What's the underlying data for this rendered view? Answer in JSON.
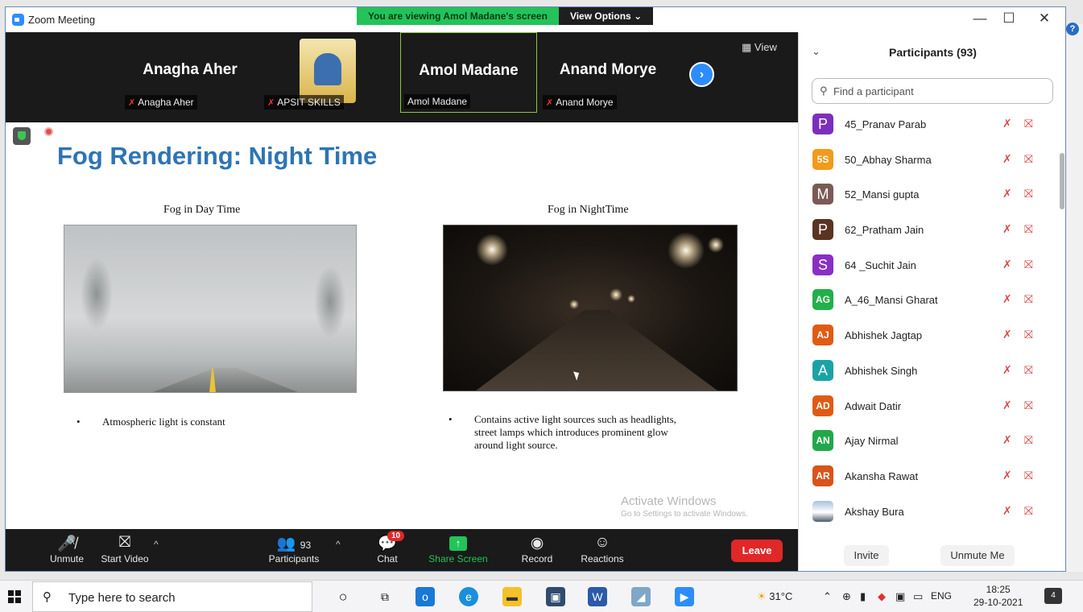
{
  "window": {
    "title": "Zoom Meeting",
    "minimize": "—",
    "maximize": "☐",
    "close": "✕"
  },
  "banner": {
    "viewing_text": "You are viewing Amol Madane's screen",
    "options_label": "View Options ⌄"
  },
  "video_strip": {
    "view_label": "View",
    "tiles": [
      {
        "display_name": "Anagha Aher",
        "label": "Anagha Aher",
        "muted": true
      },
      {
        "display_name": "",
        "label": "APSIT SKILLS",
        "muted": true
      },
      {
        "display_name": "Amol Madane",
        "label": "Amol Madane",
        "muted": false
      },
      {
        "display_name": "Anand Morye",
        "label": "Anand Morye",
        "muted": true
      }
    ]
  },
  "slide": {
    "title": "Fog Rendering: Night Time",
    "left_caption": "Fog in Day Time",
    "right_caption": "Fog in NightTime",
    "left_bullet": "Atmospheric light is constant",
    "right_bullet_lines": [
      "Contains active light sources such as headlights,",
      "street lamps which introduces prominent glow",
      "around light source."
    ]
  },
  "watermark": {
    "line1": "Activate Windows",
    "line2": "Go to Settings to activate Windows."
  },
  "toolbar": {
    "unmute": "Unmute",
    "start_video": "Start Video",
    "participants_count": "93",
    "participants": "Participants",
    "chat": "Chat",
    "chat_badge": "10",
    "share_screen": "Share Screen",
    "record": "Record",
    "reactions": "Reactions",
    "leave": "Leave"
  },
  "panel": {
    "title": "Participants (93)",
    "search_placeholder": "Find a participant",
    "invite": "Invite",
    "unmute_me": "Unmute Me",
    "participants": [
      {
        "initials": "P",
        "name": "45_Pranav Parab",
        "color": "#7b2fbf",
        "big": true
      },
      {
        "initials": "5S",
        "name": "50_Abhay Sharma",
        "color": "#f29a1a",
        "big": false
      },
      {
        "initials": "M",
        "name": "52_Mansi gupta",
        "color": "#7a5a57",
        "big": true
      },
      {
        "initials": "P",
        "name": "62_Pratham Jain",
        "color": "#5a3323",
        "big": true
      },
      {
        "initials": "S",
        "name": "64 _Suchit Jain",
        "color": "#8a2fc4",
        "big": true
      },
      {
        "initials": "AG",
        "name": "A_46_Mansi Gharat",
        "color": "#21b04a",
        "big": false
      },
      {
        "initials": "AJ",
        "name": "Abhishek Jagtap",
        "color": "#e05b12",
        "big": false
      },
      {
        "initials": "A",
        "name": "Abhishek Singh",
        "color": "#1aa3a6",
        "big": true
      },
      {
        "initials": "AD",
        "name": "Adwait Datir",
        "color": "#e05b12",
        "big": false
      },
      {
        "initials": "AN",
        "name": "Ajay Nirmal",
        "color": "#21a84a",
        "big": false
      },
      {
        "initials": "AR",
        "name": "Akansha Rawat",
        "color": "#d9531a",
        "big": false
      },
      {
        "initials": "",
        "name": "Akshay Bura",
        "color": "#8fa7c4",
        "big": false,
        "photo": true
      }
    ]
  },
  "taskbar": {
    "search_text": "Type here to search",
    "weather": "31°C",
    "language": "ENG",
    "time": "18:25",
    "date": "29-10-2021",
    "notification_count": "4"
  }
}
